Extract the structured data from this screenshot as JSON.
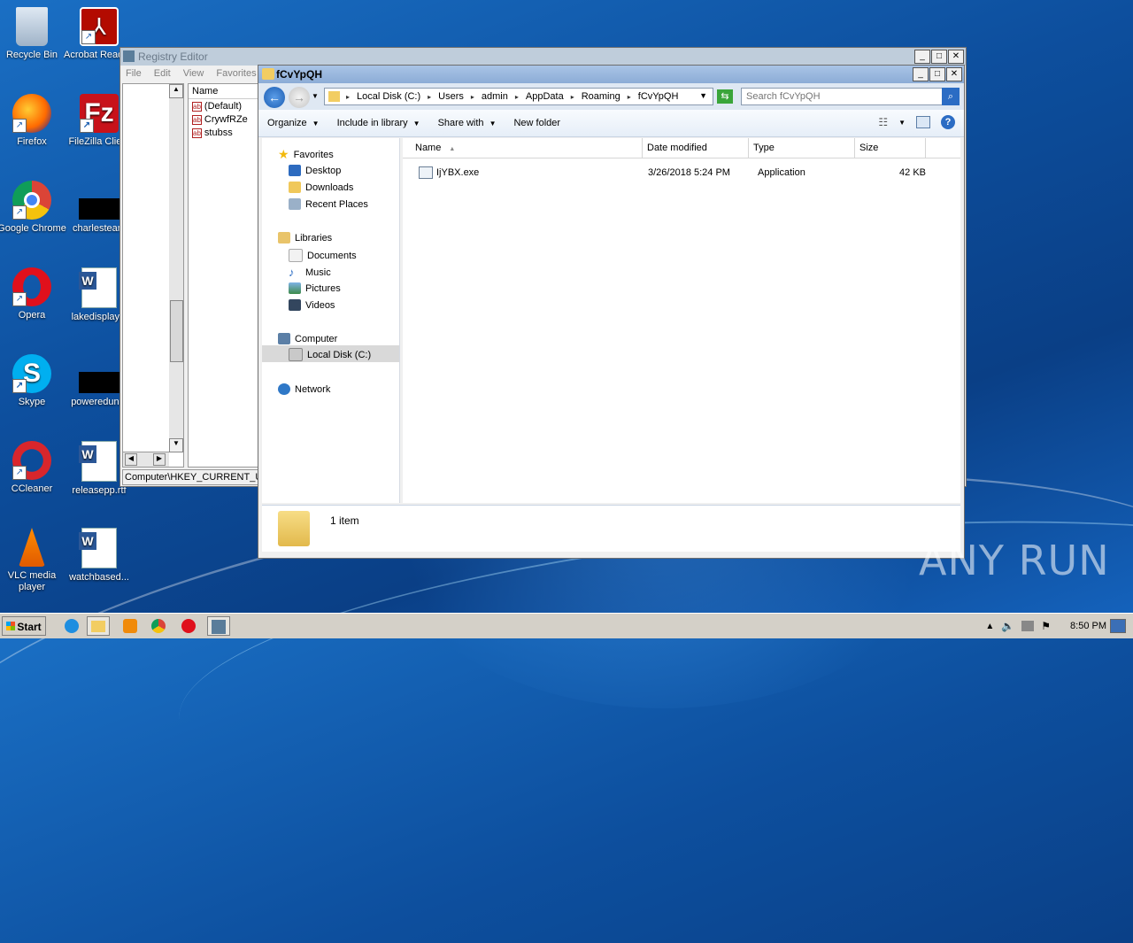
{
  "desktop": {
    "icons": [
      {
        "label": "Recycle Bin"
      },
      {
        "label": "Acrobat Reader DC"
      },
      {
        "label": "Firefox"
      },
      {
        "label": "FileZilla Client"
      },
      {
        "label": "Google Chrome"
      },
      {
        "label": "charlesteam"
      },
      {
        "label": "Opera"
      },
      {
        "label": "lakedisplay..."
      },
      {
        "label": "Skype"
      },
      {
        "label": "poweredun..."
      },
      {
        "label": "CCleaner"
      },
      {
        "label": "releasepp.rtf"
      },
      {
        "label": "VLC media player"
      },
      {
        "label": "watchbased..."
      }
    ]
  },
  "registry_editor": {
    "title": "Registry Editor",
    "menu": [
      "File",
      "Edit",
      "View",
      "Favorites"
    ],
    "column_name": "Name",
    "values": [
      "(Default)",
      "CrywfRZe",
      "stubss"
    ],
    "status": "Computer\\HKEY_CURRENT_USE"
  },
  "explorer": {
    "title": "fCvYpQH",
    "breadcrumb": [
      "Local Disk (C:)",
      "Users",
      "admin",
      "AppData",
      "Roaming",
      "fCvYpQH"
    ],
    "search_placeholder": "Search fCvYpQH",
    "toolbar": {
      "organize": "Organize",
      "include": "Include in library",
      "share": "Share with",
      "new_folder": "New folder"
    },
    "nav": {
      "favorites": "Favorites",
      "desktop": "Desktop",
      "downloads": "Downloads",
      "recent": "Recent Places",
      "libraries": "Libraries",
      "documents": "Documents",
      "music": "Music",
      "pictures": "Pictures",
      "videos": "Videos",
      "computer": "Computer",
      "local_disk": "Local Disk (C:)",
      "network": "Network"
    },
    "columns": {
      "name": "Name",
      "date": "Date modified",
      "type": "Type",
      "size": "Size"
    },
    "files": [
      {
        "name": "IjYBX.exe",
        "date": "3/26/2018 5:24 PM",
        "type": "Application",
        "size": "42 KB"
      }
    ],
    "details": "1 item"
  },
  "taskbar": {
    "start": "Start",
    "clock": "8:50 PM"
  },
  "watermark": "ANY RUN"
}
